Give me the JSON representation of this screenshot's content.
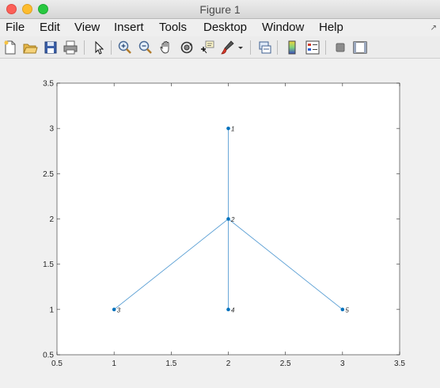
{
  "window": {
    "title": "Figure 1"
  },
  "menu": {
    "file": "File",
    "edit": "Edit",
    "view": "View",
    "insert": "Insert",
    "tools": "Tools",
    "desktop": "Desktop",
    "window": "Window",
    "help": "Help"
  },
  "toolbar": {
    "icons": [
      "new-figure-icon",
      "open-file-icon",
      "save-icon",
      "print-icon",
      "pointer-icon",
      "zoom-in-icon",
      "zoom-out-icon",
      "pan-icon",
      "rotate-3d-icon",
      "data-cursor-icon",
      "brush-icon",
      "brush-dropdown-icon",
      "link-plot-icon",
      "colorbar-icon",
      "legend-icon",
      "hide-plot-tools-icon",
      "show-plot-tools-icon"
    ]
  },
  "chart_data": {
    "type": "graph",
    "xlim": [
      0.5,
      3.5
    ],
    "ylim": [
      0.5,
      3.5
    ],
    "xticks": [
      "0.5",
      "1",
      "1.5",
      "2",
      "2.5",
      "3",
      "3.5"
    ],
    "yticks": [
      "0.5",
      "1",
      "1.5",
      "2",
      "2.5",
      "3",
      "3.5"
    ],
    "nodes": [
      {
        "id": "1",
        "x": 2,
        "y": 3
      },
      {
        "id": "2",
        "x": 2,
        "y": 2
      },
      {
        "id": "3",
        "x": 1,
        "y": 1
      },
      {
        "id": "4",
        "x": 2,
        "y": 1
      },
      {
        "id": "5",
        "x": 3,
        "y": 1
      }
    ],
    "edges": [
      [
        "1",
        "2"
      ],
      [
        "2",
        "3"
      ],
      [
        "2",
        "4"
      ],
      [
        "2",
        "5"
      ]
    ],
    "colors": {
      "node": "#0072bd",
      "edge": "#5a9fd4"
    },
    "grid": false
  }
}
